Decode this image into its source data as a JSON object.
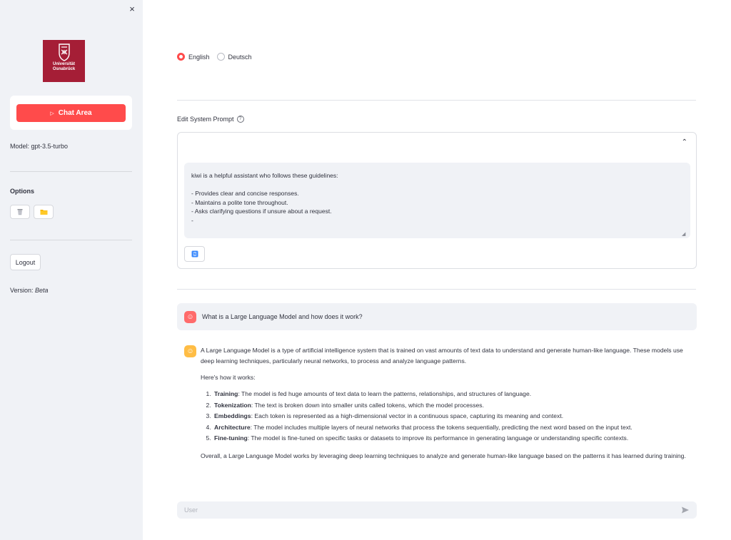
{
  "sidebar": {
    "close_glyph": "×",
    "logo": {
      "line1": "Universität",
      "line2": "Osnabrück",
      "color": "#a51e36"
    },
    "chat_button_label": "Chat Area",
    "model_info": "Model: gpt-3.5-turbo",
    "options_label": "Options",
    "option_icons": [
      "trash-icon",
      "folder-icon"
    ],
    "logout_label": "Logout",
    "version_prefix": "Version: ",
    "version_value": "Beta"
  },
  "language": {
    "options": [
      "English",
      "Deutsch"
    ],
    "selected": "English"
  },
  "system_prompt": {
    "label": "Edit System Prompt",
    "value": "kiwi is a helpful assistant who follows these guidelines:\n\n- Provides clear and concise responses.\n- Maintains a polite tone throughout.\n- Asks clarifying questions if unsure about a request.\n-"
  },
  "chat": {
    "user_message": "What is a Large Language Model and how does it work?",
    "bot_intro": "A Large Language Model is a type of artificial intelligence system that is trained on vast amounts of text data to understand and generate human-like language. These models use deep learning techniques, particularly neural networks, to process and analyze language patterns.",
    "bot_howto": "Here's how it works:",
    "bot_steps": [
      {
        "term": "Training",
        "text": ": The model is fed huge amounts of text data to learn the patterns, relationships, and structures of language."
      },
      {
        "term": "Tokenization",
        "text": ": The text is broken down into smaller units called tokens, which the model processes."
      },
      {
        "term": "Embeddings",
        "text": ": Each token is represented as a high-dimensional vector in a continuous space, capturing its meaning and context."
      },
      {
        "term": "Architecture",
        "text": ": The model includes multiple layers of neural networks that process the tokens sequentially, predicting the next word based on the input text."
      },
      {
        "term": "Fine-tuning",
        "text": ": The model is fine-tuned on specific tasks or datasets to improve its performance in generating language or understanding specific contexts."
      }
    ],
    "bot_conclusion": "Overall, a Large Language Model works by leveraging deep learning techniques to analyze and generate human-like language based on the patterns it has learned during training.",
    "input_placeholder": "User"
  },
  "colors": {
    "accent": "#ff4b4b",
    "sidebar_bg": "#f0f2f6",
    "user_avatar": "#ff6b6b",
    "bot_avatar": "#ffbd45"
  }
}
